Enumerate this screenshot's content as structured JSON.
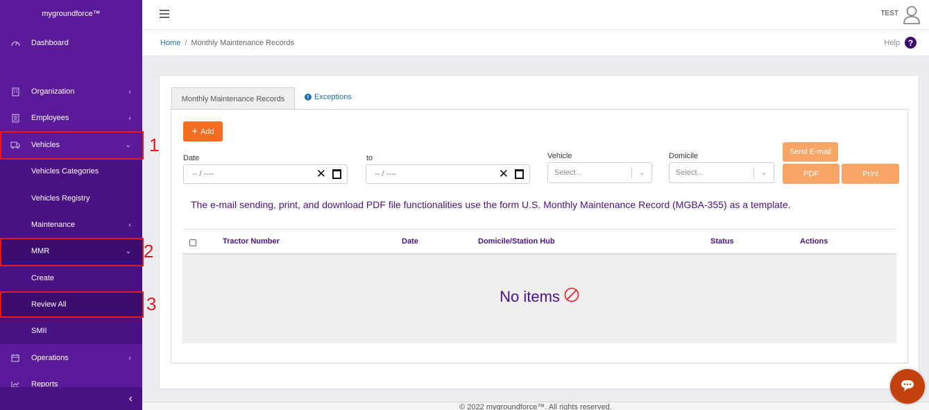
{
  "app": {
    "brand": "mygroundforce™"
  },
  "sidebar": {
    "items": [
      {
        "label": "Dashboard",
        "icon": "gauge-icon"
      },
      {
        "label": "Organization",
        "icon": "building-icon",
        "chevron": "‹"
      },
      {
        "label": "Employees",
        "icon": "id-card-icon",
        "chevron": "‹"
      },
      {
        "label": "Vehicles",
        "icon": "truck-icon",
        "chevron": "⌄"
      },
      {
        "label": "Vehicles Categories"
      },
      {
        "label": "Vehicles Registry"
      },
      {
        "label": "Maintenance",
        "chevron": "‹"
      },
      {
        "label": "MMR",
        "chevron": "⌄"
      },
      {
        "label": "Create"
      },
      {
        "label": "Review All"
      },
      {
        "label": "SMII"
      },
      {
        "label": "Operations",
        "icon": "calendar-icon",
        "chevron": "‹"
      },
      {
        "label": "Reports",
        "icon": "chart-icon"
      }
    ],
    "collapse": "‹"
  },
  "annotations": [
    "1",
    "2",
    "3"
  ],
  "header": {
    "user": "TEST"
  },
  "breadcrumb": {
    "home": "Home",
    "sep": "/",
    "current": "Monthly Maintenance Records",
    "help": "Help",
    "help_icon": "?"
  },
  "tabs": {
    "active": "Monthly Maintenance Records",
    "other": "Exceptions"
  },
  "toolbar": {
    "add": "Add",
    "send_email": "Send E-mail",
    "pdf": "PDF",
    "print": "Print"
  },
  "filters": {
    "date_label": "Date",
    "date_value": "-- / ----",
    "to_label": "to",
    "to_value": "-- / ----",
    "vehicle_label": "Vehicle",
    "vehicle_placeholder": "Select...",
    "domicile_label": "Domicile",
    "domicile_placeholder": "Select..."
  },
  "notice": "The e-mail sending, print, and download PDF file functionalities use the form U.S. Monthly Maintenance Record (MGBA-355) as a template.",
  "table": {
    "columns": [
      "Tractor Number",
      "Date",
      "Domicile/Station Hub",
      "Status",
      "Actions"
    ],
    "rows": [],
    "empty": "No items"
  },
  "footer": "© 2022 mygroundforce™. All rights reserved.",
  "colors": {
    "sidebar": "#5a1a9a",
    "accent": "#f26d1f",
    "button_light": "#f9a567",
    "text_purple": "#4a1185",
    "annotation": "#e3191e"
  }
}
